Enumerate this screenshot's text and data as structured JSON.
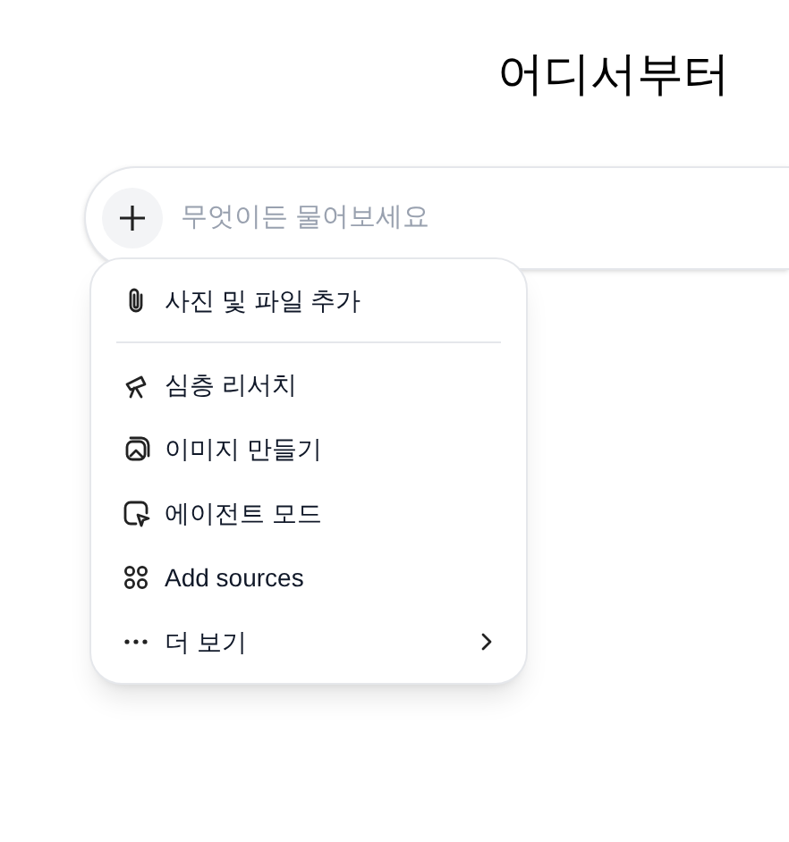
{
  "heading": "어디서부터",
  "composer": {
    "placeholder": "무엇이든 물어보세요"
  },
  "menu": {
    "groups": [
      [
        {
          "label": "사진 및 파일 추가",
          "submenu": false
        }
      ],
      [
        {
          "label": "심층 리서치",
          "submenu": false
        },
        {
          "label": "이미지 만들기",
          "submenu": false
        },
        {
          "label": "에이전트 모드",
          "submenu": false
        },
        {
          "label": "Add sources",
          "submenu": false
        },
        {
          "label": "더 보기",
          "submenu": true
        }
      ]
    ]
  }
}
